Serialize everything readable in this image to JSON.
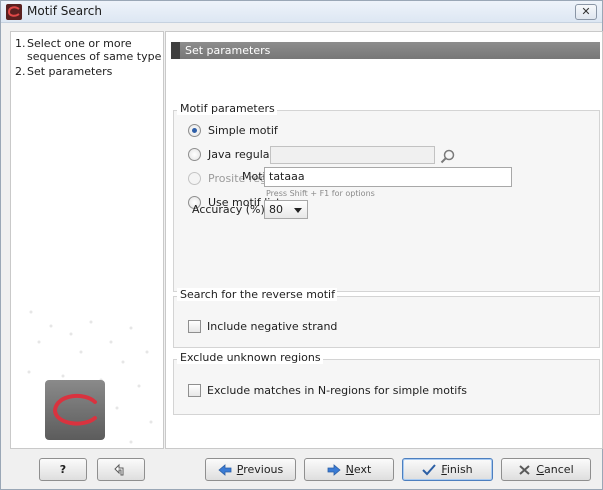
{
  "window": {
    "title": "Motif Search",
    "close_glyph": "✕"
  },
  "steps": [
    {
      "number": "1.",
      "lines": [
        "Select one or more",
        "sequences of same type"
      ]
    },
    {
      "number": "2.",
      "label": "Set parameters"
    }
  ],
  "header": {
    "title": "Set parameters"
  },
  "motif_parameters": {
    "title": "Motif parameters",
    "options": [
      {
        "label": "Simple motif",
        "checked": true,
        "enabled": true
      },
      {
        "label": "Java regular expression",
        "checked": false,
        "enabled": true
      },
      {
        "label": "Prosite regular expression",
        "checked": false,
        "enabled": false
      },
      {
        "label": "Use motif list",
        "checked": false,
        "enabled": true
      }
    ],
    "motif_label": "Motif:",
    "motif_value": "tataaa",
    "motif_hint": "Press Shift + F1 for options",
    "accuracy_label": "Accuracy (%):",
    "accuracy_value": "80"
  },
  "reverse": {
    "title": "Search for the reverse motif",
    "checkbox_label": "Include negative strand",
    "checked": false
  },
  "exclude": {
    "title": "Exclude unknown regions",
    "checkbox_label": "Exclude matches in N-regions for simple motifs",
    "checked": false
  },
  "buttons": {
    "help": "?",
    "previous": {
      "mnemonic": "P",
      "rest": "revious"
    },
    "next": {
      "mnemonic": "N",
      "rest": "ext"
    },
    "finish": {
      "mnemonic": "F",
      "rest": "inish"
    },
    "cancel": {
      "mnemonic": "C",
      "rest": "ancel"
    }
  },
  "icons": {
    "app": "motif-search-app-icon",
    "folder": "browse-folder-icon",
    "reset": "reset-arrow-icon",
    "previous": "arrow-left-icon",
    "next": "arrow-right-icon",
    "finish": "checkmark-icon",
    "cancel": "cross-icon"
  },
  "colors": {
    "header_bg": "#858585",
    "primary_border": "#4d7fbf",
    "radio_dot": "#2f5fa8"
  }
}
